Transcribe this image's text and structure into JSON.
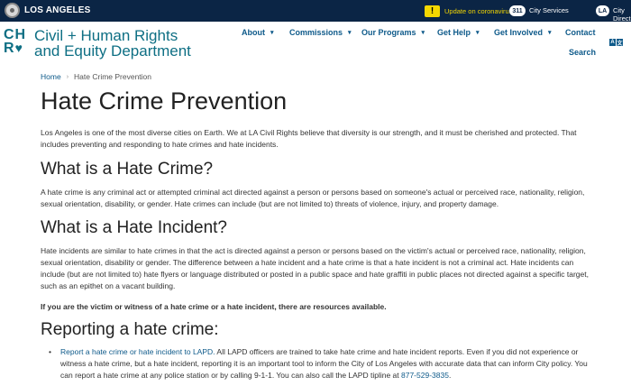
{
  "topbar": {
    "city_name": "LOS ANGELES",
    "covid_icon": "!",
    "covid_link": "Update on coronavirus",
    "services_badge": "311",
    "services_link": "City Services",
    "directory_badge": "LA",
    "directory_link": "City Directory",
    "bar_color": "#0b2545",
    "accent_color": "#f5d800"
  },
  "header": {
    "logo_mark_line1": "CH",
    "logo_mark_line2_letter": "R",
    "logo_mark_heart": "♥",
    "logo_title_line1": "Civil + Human Rights",
    "logo_title_line2": "and Equity Department",
    "brand_color": "#0e6f84",
    "nav": [
      {
        "label": "About",
        "caret": "▾"
      },
      {
        "label": "Commissions",
        "caret": "▾"
      },
      {
        "label": "Our Programs",
        "caret": "▾"
      },
      {
        "label": "Get Help",
        "caret": "▾"
      },
      {
        "label": "Get Involved",
        "caret": "▾"
      },
      {
        "label": "Contact"
      },
      {
        "label": "Search"
      }
    ],
    "translate_icon": [
      "A",
      "文"
    ]
  },
  "breadcrumb": {
    "home": "Home",
    "separator": "›",
    "current": "Hate Crime Prevention"
  },
  "main": {
    "title": "Hate Crime Prevention",
    "intro": "Los Angeles is one of the most diverse cities on Earth. We at LA Civil Rights believe that diversity is our strength, and it must be cherished and protected. That includes preventing and responding to hate crimes and hate incidents.",
    "crime_heading": "What is a Hate Crime?",
    "crime_text": "A hate crime is any criminal act or attempted criminal act directed against a person or persons based on someone's actual or perceived race, nationality, religion, sexual orientation, disability, or gender. Hate crimes can include (but are not limited to) threats of violence, injury, and property damage.",
    "incident_heading": "What is a Hate Incident?",
    "incident_text": "Hate incidents are similar to hate crimes in that the act is directed against a person or persons based on the victim's actual or perceived race, nationality, religion, sexual orientation, disability or gender. The difference between a hate incident and a hate crime is that a hate incident is not a criminal act. Hate incidents can include (but are not limited to) hate flyers or language distributed or posted in a public space and hate graffiti in public places not directed against a specific target, such as an epithet on a vacant building.",
    "victim_text": "If you are the victim or witness of a hate crime or a hate incident, there are resources available.",
    "report_heading": "Reporting a hate crime:",
    "report_item": {
      "bullet": "•",
      "link_text": "Report a hate crime or hate incident to LAPD.",
      "text": " All LAPD officers are trained to take hate crime and hate incident reports. Even if you did not experience or witness a hate crime, but a hate incident, reporting it is an important tool to inform the City of Los Angeles with accurate data that can inform City policy. You can report a hate crime at any police station or by calling 9-1-1. You can also call the LAPD tipline at ",
      "phone": "877-529-3835",
      "end": "."
    },
    "link_color": "#0e5a8a"
  }
}
